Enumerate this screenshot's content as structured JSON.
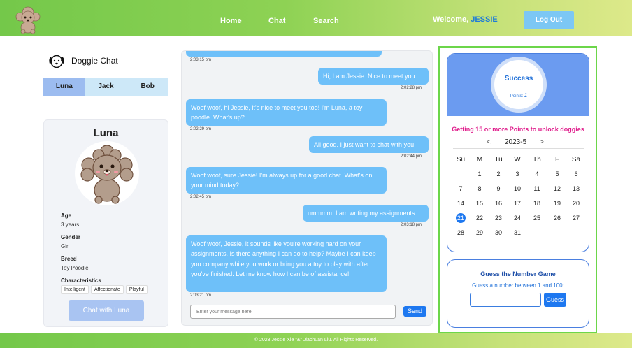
{
  "header": {
    "nav": [
      "Home",
      "Chat",
      "Search"
    ],
    "welcome_prefix": "Welcome,",
    "username": "JESSIE",
    "logout_label": "Log Out"
  },
  "sidebar": {
    "brand": "Doggie Chat",
    "tabs": [
      "Luna",
      "Jack",
      "Bob"
    ],
    "active_tab": "Luna"
  },
  "profile": {
    "name": "Luna",
    "age_label": "Age",
    "age": "3 years",
    "gender_label": "Gender",
    "gender": "Girl",
    "breed_label": "Breed",
    "breed": "Toy Poodle",
    "characteristics_label": "Characteristics",
    "characteristics": [
      "Intelligent",
      "Affectionate",
      "Playful"
    ],
    "chat_button": "Chat with Luna"
  },
  "chat": {
    "messages": [
      {
        "from": "dog",
        "text": "",
        "time": "2:03:15 pm"
      },
      {
        "from": "user",
        "text": "Hi, I am Jessie. Nice to meet you.",
        "time": "2:02:28 pm"
      },
      {
        "from": "dog",
        "text": "Woof woof, hi Jessie, it's nice to meet you too! I'm Luna, a toy poodle. What's up?",
        "time": "2:02:29 pm"
      },
      {
        "from": "user",
        "text": "All good. I just want to chat with you",
        "time": "2:02:44 pm"
      },
      {
        "from": "dog",
        "text": "Woof woof, sure Jessie! I'm always up for a good chat. What's on your mind today?",
        "time": "2:02:45 pm"
      },
      {
        "from": "user",
        "text": "ummmm. I am writing my assignments",
        "time": "2:03:18 pm"
      },
      {
        "from": "dog",
        "text": "Woof woof, Jessie, it sounds like you're working hard on your assignments. Is there anything I can do to help? Maybe I can keep you company while you work or bring you a toy to play with after you've finished. Let me know how I can be of assistance!",
        "time": "2:03:21 pm"
      }
    ],
    "input_placeholder": "Enter your message here",
    "send_label": "Send"
  },
  "points_card": {
    "status": "Success",
    "points_label": "Points:",
    "points": "1",
    "unlock_text": "Getting 15 or more Points to unlock doggies"
  },
  "calendar": {
    "prev": "<",
    "month_label": "2023-5",
    "next": ">",
    "weekdays": [
      "Su",
      "M",
      "Tu",
      "W",
      "Th",
      "F",
      "Sa"
    ],
    "weeks": [
      [
        "",
        "1",
        "2",
        "3",
        "4",
        "5",
        "6"
      ],
      [
        "7",
        "8",
        "9",
        "10",
        "11",
        "12",
        "13"
      ],
      [
        "14",
        "15",
        "16",
        "17",
        "18",
        "19",
        "20"
      ],
      [
        "21",
        "22",
        "23",
        "24",
        "25",
        "26",
        "27"
      ],
      [
        "28",
        "29",
        "30",
        "31",
        "",
        "",
        ""
      ]
    ],
    "today": "21"
  },
  "guess": {
    "title": "Guess the Number Game",
    "subtitle": "Guess a number between 1 and 100:",
    "input_value": "",
    "button": "Guess"
  },
  "footer": {
    "text": "© 2023 Jessie Xie \"&\" Jiachuan Liu. All Rights Reserved."
  },
  "colors": {
    "header_green": "#8ed254",
    "accent_blue": "#1e78f0",
    "bubble_blue": "#6ec0f9",
    "panel_border": "#6cd64a",
    "unlock_pink": "#e01e8c"
  }
}
